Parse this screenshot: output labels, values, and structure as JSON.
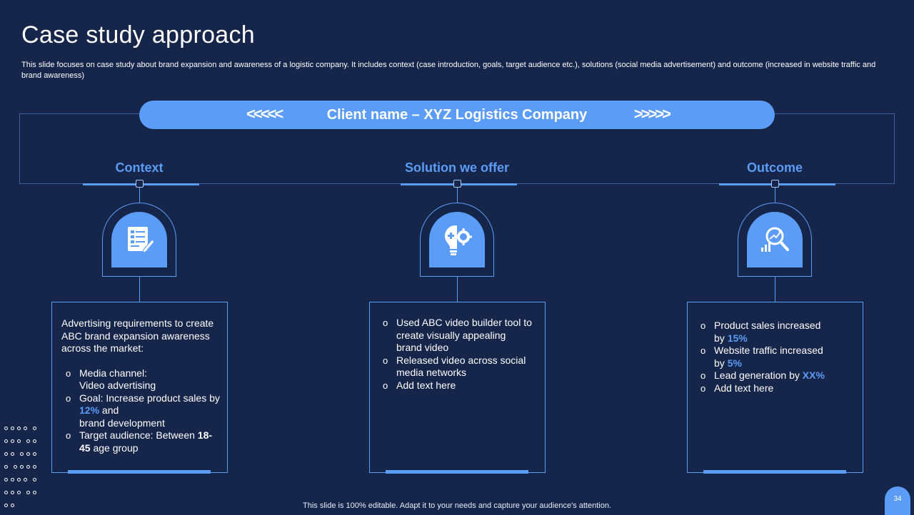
{
  "slide": {
    "title": "Case study approach",
    "description": "This slide focuses on case study about brand expansion and awareness of a logistic company. It includes context (case introduction, goals, target audience etc.), solutions (social media advertisement) and outcome (increased in website traffic and brand awareness)",
    "footer": "This slide is 100% editable. Adapt it to your needs and capture your audience's attention.",
    "page_number": "34"
  },
  "client": {
    "left_chevrons": "<<<<<",
    "label": "Client name – XYZ Logistics Company",
    "right_chevrons": ">>>>>"
  },
  "columns": {
    "context": {
      "heading": "Context",
      "icon": "document-checklist-icon",
      "intro": "Advertising requirements to create ABC brand expansion awareness across the market:",
      "b1_line1": "Media channel:",
      "b1_line2": "Video advertising",
      "b2_pre": "Goal: Increase product sales by ",
      "b2_value": "12%",
      "b2_mid": " and",
      "b2_line2": "brand development",
      "b3_pre": "Target audience: Between ",
      "b3_value": "18-45",
      "b3_post": " age group"
    },
    "solution": {
      "heading": "Solution  we offer",
      "icon": "lightbulb-gear-icon",
      "bullets": [
        "Used ABC video builder tool to create visually appealing brand video",
        "Released video across social media networks",
        "Add text here"
      ]
    },
    "outcome": {
      "heading": "Outcome",
      "icon": "growth-analysis-icon",
      "b1_pre": "Product sales increased by ",
      "b1_value": "15%",
      "b2_pre": "Website traffic increased by ",
      "b2_value": "5%",
      "b3_pre": "Lead generation by ",
      "b3_value": "XX%",
      "b4": "Add text here"
    }
  },
  "colors": {
    "background": "#16254a",
    "accent": "#5b9cf6"
  }
}
